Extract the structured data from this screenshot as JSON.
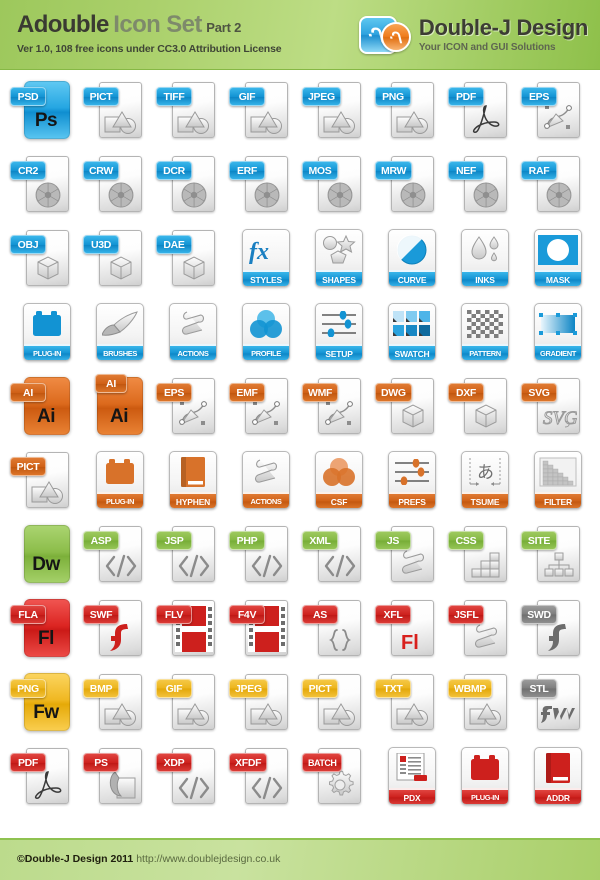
{
  "header": {
    "title_bold": "Adouble",
    "title_gray": "Icon Set",
    "title_part": "Part 2",
    "subtitle": "Ver 1.0, 108 free icons under CC3.0 Attribution License",
    "logo_title": "Double-J Design",
    "logo_subtitle": "Your ICON and GUI Solutions",
    "colors": {
      "green_light": "#bddd85",
      "green_dark": "#8ec04a",
      "title_dark": "#3a3a32",
      "title_gray": "#7e8a6b"
    }
  },
  "palette": {
    "photoshop_blue": "#1293d3",
    "illustrator_orange": "#cf6016",
    "dreamweaver_green": "#84b844",
    "flash_red": "#cd201d",
    "fireworks_gold": "#ecb41b",
    "acrobat_red": "#cd201d",
    "gray": "#7d7d7d",
    "document_white": "#ffffff"
  },
  "rows": [
    {
      "family": "photoshop",
      "color": "blue",
      "items": [
        {
          "label": "PSD",
          "type": "app",
          "mono": "Ps",
          "art": "none"
        },
        {
          "label": "PICT",
          "type": "doc",
          "art": "image-shapes"
        },
        {
          "label": "TIFF",
          "type": "doc",
          "art": "image-shapes"
        },
        {
          "label": "GIF",
          "type": "doc",
          "art": "image-shapes"
        },
        {
          "label": "JPEG",
          "type": "doc",
          "art": "image-shapes"
        },
        {
          "label": "PNG",
          "type": "doc",
          "art": "image-shapes"
        },
        {
          "label": "PDF",
          "type": "doc",
          "art": "acrobat-swirl"
        },
        {
          "label": "EPS",
          "type": "doc",
          "art": "pen-path"
        }
      ]
    },
    {
      "family": "camera-raw",
      "color": "blue",
      "items": [
        {
          "label": "CR2",
          "type": "doc",
          "art": "aperture"
        },
        {
          "label": "CRW",
          "type": "doc",
          "art": "aperture"
        },
        {
          "label": "DCR",
          "type": "doc",
          "art": "aperture"
        },
        {
          "label": "ERF",
          "type": "doc",
          "art": "aperture"
        },
        {
          "label": "MOS",
          "type": "doc",
          "art": "aperture"
        },
        {
          "label": "MRW",
          "type": "doc",
          "art": "aperture"
        },
        {
          "label": "NEF",
          "type": "doc",
          "art": "aperture"
        },
        {
          "label": "RAF",
          "type": "doc",
          "art": "aperture"
        }
      ]
    },
    {
      "family": "3d-and-tools",
      "color": "blue",
      "items": [
        {
          "label": "OBJ",
          "type": "doc",
          "art": "cube"
        },
        {
          "label": "U3D",
          "type": "doc",
          "art": "cube"
        },
        {
          "label": "DAE",
          "type": "doc",
          "art": "cube"
        },
        {
          "label": "STYLES",
          "type": "tile",
          "art": "fx"
        },
        {
          "label": "SHAPES",
          "type": "tile",
          "art": "shapes"
        },
        {
          "label": "CURVE",
          "type": "tile",
          "art": "curve"
        },
        {
          "label": "INKS",
          "type": "tile",
          "art": "inks"
        },
        {
          "label": "MASK",
          "type": "tile",
          "art": "mask"
        }
      ]
    },
    {
      "family": "photoshop-tools",
      "color": "blue",
      "items": [
        {
          "label": "PLUG-IN",
          "type": "tile",
          "art": "plug-in"
        },
        {
          "label": "BRUSHES",
          "type": "tile",
          "art": "brush"
        },
        {
          "label": "ACTIONS",
          "type": "tile",
          "art": "scroll"
        },
        {
          "label": "PROFILE",
          "type": "tile",
          "art": "circles"
        },
        {
          "label": "SETUP",
          "type": "tile",
          "art": "sliders"
        },
        {
          "label": "SWATCH",
          "type": "tile",
          "art": "swatch"
        },
        {
          "label": "PATTERN",
          "type": "tile",
          "art": "checker"
        },
        {
          "label": "GRADIENT",
          "type": "tile",
          "art": "gradient"
        }
      ]
    },
    {
      "family": "illustrator",
      "color": "orange",
      "items": [
        {
          "label": "AI",
          "type": "app",
          "mono": "Ai",
          "art": "none"
        },
        {
          "label": "AI",
          "type": "app2",
          "mono": "Ai",
          "art": "none"
        },
        {
          "label": "EPS",
          "type": "doc",
          "art": "pen-path"
        },
        {
          "label": "EMF",
          "type": "doc",
          "art": "pen-path"
        },
        {
          "label": "WMF",
          "type": "doc",
          "art": "pen-path"
        },
        {
          "label": "DWG",
          "type": "doc",
          "art": "cube"
        },
        {
          "label": "DXF",
          "type": "doc",
          "art": "cube"
        },
        {
          "label": "SVG",
          "type": "doc",
          "art": "svg-text"
        }
      ]
    },
    {
      "family": "illustrator-tools",
      "color": "orange",
      "items": [
        {
          "label": "PICT",
          "type": "doc",
          "art": "image-shapes"
        },
        {
          "label": "PLUG-IN",
          "type": "tile",
          "art": "plug-in"
        },
        {
          "label": "HYPHEN",
          "type": "tile",
          "art": "book"
        },
        {
          "label": "ACTIONS",
          "type": "tile",
          "art": "scroll"
        },
        {
          "label": "CSF",
          "type": "tile",
          "art": "circles"
        },
        {
          "label": "PREFS",
          "type": "tile",
          "art": "sliders"
        },
        {
          "label": "TSUME",
          "type": "tile",
          "art": "tsume"
        },
        {
          "label": "FILTER",
          "type": "tile",
          "art": "filter"
        }
      ]
    },
    {
      "family": "dreamweaver",
      "color": "green",
      "items": [
        {
          "label": "",
          "type": "app",
          "mono": "Dw",
          "art": "none"
        },
        {
          "label": "ASP",
          "type": "doc",
          "art": "code"
        },
        {
          "label": "JSP",
          "type": "doc",
          "art": "code"
        },
        {
          "label": "PHP",
          "type": "doc",
          "art": "code"
        },
        {
          "label": "XML",
          "type": "doc",
          "art": "code"
        },
        {
          "label": "JS",
          "type": "doc",
          "art": "scroll"
        },
        {
          "label": "CSS",
          "type": "doc",
          "art": "blocks"
        },
        {
          "label": "SITE",
          "type": "doc",
          "art": "sitemap"
        }
      ]
    },
    {
      "family": "flash",
      "color": "red",
      "items": [
        {
          "label": "FLA",
          "type": "app",
          "mono": "Fl",
          "art": "none"
        },
        {
          "label": "SWF",
          "type": "doc",
          "art": "flash-f"
        },
        {
          "label": "FLV",
          "type": "doc",
          "art": "filmstrip"
        },
        {
          "label": "F4V",
          "type": "doc",
          "art": "filmstrip"
        },
        {
          "label": "AS",
          "type": "doc",
          "art": "braces"
        },
        {
          "label": "XFL",
          "type": "doc",
          "art": "fl-red"
        },
        {
          "label": "JSFL",
          "type": "doc",
          "art": "scroll"
        },
        {
          "label": "SWD",
          "type": "doc",
          "art": "flash-f-gray",
          "badge_color": "gray"
        }
      ]
    },
    {
      "family": "fireworks",
      "color": "gold",
      "items": [
        {
          "label": "PNG",
          "type": "app",
          "mono": "Fw",
          "art": "none"
        },
        {
          "label": "BMP",
          "type": "doc",
          "art": "image-shapes"
        },
        {
          "label": "GIF",
          "type": "doc",
          "art": "image-shapes"
        },
        {
          "label": "JPEG",
          "type": "doc",
          "art": "image-shapes"
        },
        {
          "label": "PICT",
          "type": "doc",
          "art": "image-shapes"
        },
        {
          "label": "TXT",
          "type": "doc",
          "art": "image-shapes"
        },
        {
          "label": "WBMP",
          "type": "doc",
          "art": "image-shapes"
        },
        {
          "label": "STL",
          "type": "doc",
          "art": "fireworks-fw",
          "badge_color": "gray"
        }
      ]
    },
    {
      "family": "acrobat",
      "color": "red",
      "items": [
        {
          "label": "PDF",
          "type": "doc",
          "art": "acrobat-swirl"
        },
        {
          "label": "PS",
          "type": "doc",
          "art": "ps-art"
        },
        {
          "label": "XDP",
          "type": "doc",
          "art": "code"
        },
        {
          "label": "XFDF",
          "type": "doc",
          "art": "code"
        },
        {
          "label": "BATCH",
          "type": "doc",
          "art": "gear"
        },
        {
          "label": "PDX",
          "type": "tile",
          "art": "list-doc"
        },
        {
          "label": "PLUG-IN",
          "type": "tile",
          "art": "plug-in"
        },
        {
          "label": "ADDR",
          "type": "tile",
          "art": "book"
        }
      ]
    }
  ],
  "footer": {
    "copyright": "©Double-J Design 2011",
    "url": "http://www.doublejdesign.co.uk"
  }
}
